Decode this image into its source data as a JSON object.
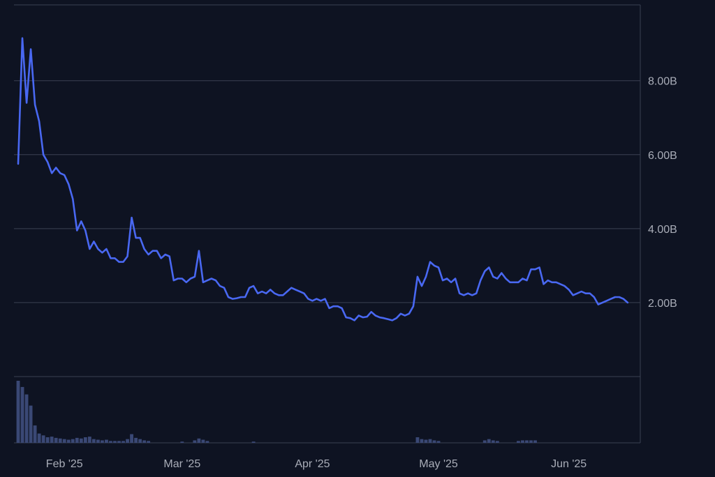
{
  "colors": {
    "background": "#0e1322",
    "grid": "#3b4152",
    "axis_text": "#a9adb8",
    "line": "#4968f2",
    "volume": "#3a4875"
  },
  "chart_data": {
    "type": "line",
    "title": "",
    "xlabel": "",
    "ylabel": "",
    "y_unit": "B",
    "ylim": [
      0,
      10.05
    ],
    "grid": true,
    "y_gridlines": [
      2,
      4,
      6,
      8
    ],
    "y_tick_labels": [
      "2.00B",
      "4.00B",
      "6.00B",
      "8.00B"
    ],
    "x_tick_labels": [
      {
        "date": "2025-02-01",
        "label": "Feb '25"
      },
      {
        "date": "2025-03-01",
        "label": "Mar '25"
      },
      {
        "date": "2025-04-01",
        "label": "Apr '25"
      },
      {
        "date": "2025-05-01",
        "label": "May '25"
      },
      {
        "date": "2025-06-01",
        "label": "Jun '25"
      }
    ],
    "x_range": [
      "2025-01-20",
      "2025-06-18"
    ],
    "series": [
      {
        "type": "line",
        "points": [
          [
            "2025-01-21",
            5.75
          ],
          [
            "2025-01-22",
            9.15
          ],
          [
            "2025-01-23",
            7.4
          ],
          [
            "2025-01-24",
            8.85
          ],
          [
            "2025-01-25",
            7.35
          ],
          [
            "2025-01-26",
            6.9
          ],
          [
            "2025-01-27",
            6.0
          ],
          [
            "2025-01-28",
            5.8
          ],
          [
            "2025-01-29",
            5.5
          ],
          [
            "2025-01-30",
            5.65
          ],
          [
            "2025-01-31",
            5.5
          ],
          [
            "2025-02-01",
            5.45
          ],
          [
            "2025-02-02",
            5.2
          ],
          [
            "2025-02-03",
            4.8
          ],
          [
            "2025-02-04",
            3.95
          ],
          [
            "2025-02-05",
            4.2
          ],
          [
            "2025-02-06",
            3.95
          ],
          [
            "2025-02-07",
            3.45
          ],
          [
            "2025-02-08",
            3.65
          ],
          [
            "2025-02-09",
            3.45
          ],
          [
            "2025-02-10",
            3.35
          ],
          [
            "2025-02-11",
            3.45
          ],
          [
            "2025-02-12",
            3.2
          ],
          [
            "2025-02-13",
            3.2
          ],
          [
            "2025-02-14",
            3.1
          ],
          [
            "2025-02-15",
            3.1
          ],
          [
            "2025-02-16",
            3.25
          ],
          [
            "2025-02-17",
            4.3
          ],
          [
            "2025-02-18",
            3.75
          ],
          [
            "2025-02-19",
            3.75
          ],
          [
            "2025-02-20",
            3.45
          ],
          [
            "2025-02-21",
            3.3
          ],
          [
            "2025-02-22",
            3.4
          ],
          [
            "2025-02-23",
            3.4
          ],
          [
            "2025-02-24",
            3.2
          ],
          [
            "2025-02-25",
            3.3
          ],
          [
            "2025-02-26",
            3.25
          ],
          [
            "2025-02-27",
            2.6
          ],
          [
            "2025-02-28",
            2.65
          ],
          [
            "2025-03-01",
            2.65
          ],
          [
            "2025-03-02",
            2.55
          ],
          [
            "2025-03-03",
            2.65
          ],
          [
            "2025-03-04",
            2.7
          ],
          [
            "2025-03-05",
            3.4
          ],
          [
            "2025-03-06",
            2.55
          ],
          [
            "2025-03-07",
            2.6
          ],
          [
            "2025-03-08",
            2.65
          ],
          [
            "2025-03-09",
            2.6
          ],
          [
            "2025-03-10",
            2.45
          ],
          [
            "2025-03-11",
            2.4
          ],
          [
            "2025-03-12",
            2.15
          ],
          [
            "2025-03-13",
            2.1
          ],
          [
            "2025-03-14",
            2.12
          ],
          [
            "2025-03-15",
            2.15
          ],
          [
            "2025-03-16",
            2.15
          ],
          [
            "2025-03-17",
            2.4
          ],
          [
            "2025-03-18",
            2.45
          ],
          [
            "2025-03-19",
            2.25
          ],
          [
            "2025-03-20",
            2.3
          ],
          [
            "2025-03-21",
            2.25
          ],
          [
            "2025-03-22",
            2.35
          ],
          [
            "2025-03-23",
            2.25
          ],
          [
            "2025-03-24",
            2.2
          ],
          [
            "2025-03-25",
            2.2
          ],
          [
            "2025-03-26",
            2.3
          ],
          [
            "2025-03-27",
            2.4
          ],
          [
            "2025-03-28",
            2.35
          ],
          [
            "2025-03-29",
            2.3
          ],
          [
            "2025-03-30",
            2.25
          ],
          [
            "2025-03-31",
            2.1
          ],
          [
            "2025-04-01",
            2.05
          ],
          [
            "2025-04-02",
            2.1
          ],
          [
            "2025-04-03",
            2.05
          ],
          [
            "2025-04-04",
            2.1
          ],
          [
            "2025-04-05",
            1.85
          ],
          [
            "2025-04-06",
            1.9
          ],
          [
            "2025-04-07",
            1.9
          ],
          [
            "2025-04-08",
            1.85
          ],
          [
            "2025-04-09",
            1.6
          ],
          [
            "2025-04-10",
            1.58
          ],
          [
            "2025-04-11",
            1.52
          ],
          [
            "2025-04-12",
            1.65
          ],
          [
            "2025-04-13",
            1.6
          ],
          [
            "2025-04-14",
            1.62
          ],
          [
            "2025-04-15",
            1.75
          ],
          [
            "2025-04-16",
            1.65
          ],
          [
            "2025-04-17",
            1.6
          ],
          [
            "2025-04-18",
            1.58
          ],
          [
            "2025-04-19",
            1.55
          ],
          [
            "2025-04-20",
            1.52
          ],
          [
            "2025-04-21",
            1.58
          ],
          [
            "2025-04-22",
            1.7
          ],
          [
            "2025-04-23",
            1.65
          ],
          [
            "2025-04-24",
            1.7
          ],
          [
            "2025-04-25",
            1.9
          ],
          [
            "2025-04-26",
            2.7
          ],
          [
            "2025-04-27",
            2.45
          ],
          [
            "2025-04-28",
            2.7
          ],
          [
            "2025-04-29",
            3.1
          ],
          [
            "2025-04-30",
            3.0
          ],
          [
            "2025-05-01",
            2.95
          ],
          [
            "2025-05-02",
            2.6
          ],
          [
            "2025-05-03",
            2.65
          ],
          [
            "2025-05-04",
            2.55
          ],
          [
            "2025-05-05",
            2.65
          ],
          [
            "2025-05-06",
            2.25
          ],
          [
            "2025-05-07",
            2.2
          ],
          [
            "2025-05-08",
            2.25
          ],
          [
            "2025-05-09",
            2.2
          ],
          [
            "2025-05-10",
            2.25
          ],
          [
            "2025-05-11",
            2.6
          ],
          [
            "2025-05-12",
            2.85
          ],
          [
            "2025-05-13",
            2.95
          ],
          [
            "2025-05-14",
            2.7
          ],
          [
            "2025-05-15",
            2.65
          ],
          [
            "2025-05-16",
            2.8
          ],
          [
            "2025-05-17",
            2.65
          ],
          [
            "2025-05-18",
            2.55
          ],
          [
            "2025-05-19",
            2.55
          ],
          [
            "2025-05-20",
            2.55
          ],
          [
            "2025-05-21",
            2.65
          ],
          [
            "2025-05-22",
            2.6
          ],
          [
            "2025-05-23",
            2.9
          ],
          [
            "2025-05-24",
            2.9
          ],
          [
            "2025-05-25",
            2.95
          ],
          [
            "2025-05-26",
            2.5
          ],
          [
            "2025-05-27",
            2.6
          ],
          [
            "2025-05-28",
            2.55
          ],
          [
            "2025-05-29",
            2.55
          ],
          [
            "2025-05-30",
            2.5
          ],
          [
            "2025-05-31",
            2.45
          ],
          [
            "2025-06-01",
            2.35
          ],
          [
            "2025-06-02",
            2.2
          ],
          [
            "2025-06-03",
            2.25
          ],
          [
            "2025-06-04",
            2.3
          ],
          [
            "2025-06-05",
            2.25
          ],
          [
            "2025-06-06",
            2.25
          ],
          [
            "2025-06-07",
            2.15
          ],
          [
            "2025-06-08",
            1.95
          ],
          [
            "2025-06-09",
            2.0
          ],
          [
            "2025-06-10",
            2.05
          ],
          [
            "2025-06-11",
            2.1
          ],
          [
            "2025-06-12",
            2.15
          ],
          [
            "2025-06-13",
            2.15
          ],
          [
            "2025-06-14",
            2.1
          ],
          [
            "2025-06-15",
            2.0
          ]
        ]
      },
      {
        "type": "bar",
        "values": [
          [
            "2025-01-21",
            1.0
          ],
          [
            "2025-01-22",
            0.9
          ],
          [
            "2025-01-23",
            0.78
          ],
          [
            "2025-01-24",
            0.6
          ],
          [
            "2025-01-25",
            0.28
          ],
          [
            "2025-01-26",
            0.15
          ],
          [
            "2025-01-27",
            0.12
          ],
          [
            "2025-01-28",
            0.09
          ],
          [
            "2025-01-29",
            0.1
          ],
          [
            "2025-01-30",
            0.08
          ],
          [
            "2025-01-31",
            0.07
          ],
          [
            "2025-02-01",
            0.06
          ],
          [
            "2025-02-02",
            0.05
          ],
          [
            "2025-02-03",
            0.06
          ],
          [
            "2025-02-04",
            0.08
          ],
          [
            "2025-02-05",
            0.07
          ],
          [
            "2025-02-06",
            0.09
          ],
          [
            "2025-02-07",
            0.1
          ],
          [
            "2025-02-08",
            0.06
          ],
          [
            "2025-02-09",
            0.05
          ],
          [
            "2025-02-10",
            0.04
          ],
          [
            "2025-02-11",
            0.05
          ],
          [
            "2025-02-12",
            0.03
          ],
          [
            "2025-02-13",
            0.03
          ],
          [
            "2025-02-14",
            0.03
          ],
          [
            "2025-02-15",
            0.03
          ],
          [
            "2025-02-16",
            0.06
          ],
          [
            "2025-02-17",
            0.14
          ],
          [
            "2025-02-18",
            0.08
          ],
          [
            "2025-02-19",
            0.06
          ],
          [
            "2025-02-20",
            0.04
          ],
          [
            "2025-02-21",
            0.03
          ],
          [
            "2025-03-01",
            0.02
          ],
          [
            "2025-03-04",
            0.04
          ],
          [
            "2025-03-05",
            0.07
          ],
          [
            "2025-03-06",
            0.05
          ],
          [
            "2025-03-07",
            0.03
          ],
          [
            "2025-03-18",
            0.02
          ],
          [
            "2025-04-26",
            0.09
          ],
          [
            "2025-04-27",
            0.06
          ],
          [
            "2025-04-28",
            0.05
          ],
          [
            "2025-04-29",
            0.06
          ],
          [
            "2025-04-30",
            0.04
          ],
          [
            "2025-05-01",
            0.03
          ],
          [
            "2025-05-12",
            0.04
          ],
          [
            "2025-05-13",
            0.06
          ],
          [
            "2025-05-14",
            0.04
          ],
          [
            "2025-05-15",
            0.03
          ],
          [
            "2025-05-20",
            0.03
          ],
          [
            "2025-05-21",
            0.04
          ],
          [
            "2025-05-22",
            0.04
          ],
          [
            "2025-05-23",
            0.04
          ],
          [
            "2025-05-24",
            0.04
          ]
        ]
      }
    ]
  }
}
